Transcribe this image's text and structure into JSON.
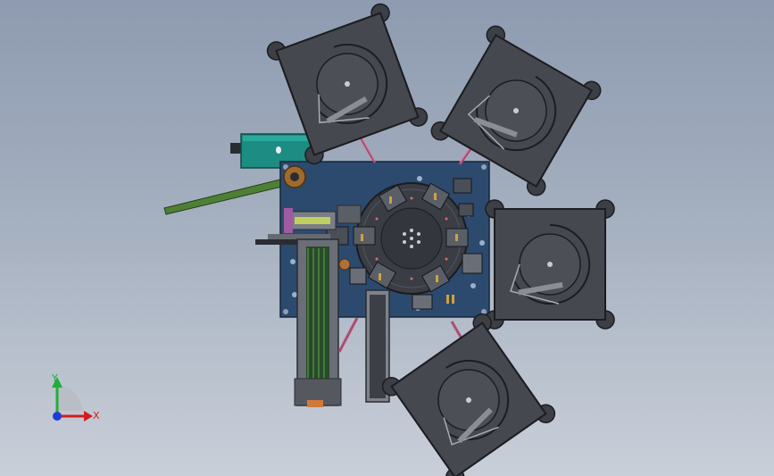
{
  "triad": {
    "x_label": "X",
    "y_label": "Y"
  },
  "colors": {
    "background_top": "#8e9bb0",
    "background_bottom": "#c9cfd9",
    "plate": "#2c4a6e",
    "bowl": "#45484f",
    "bowl_edge": "#2a2c31",
    "motor_box": "#1d8c82",
    "rail_green": "#4e7f35",
    "feed_tube": "#b04a72",
    "axis_x": "#d21e1e",
    "axis_y": "#1fae3a",
    "axis_z": "#1b3fd4"
  }
}
